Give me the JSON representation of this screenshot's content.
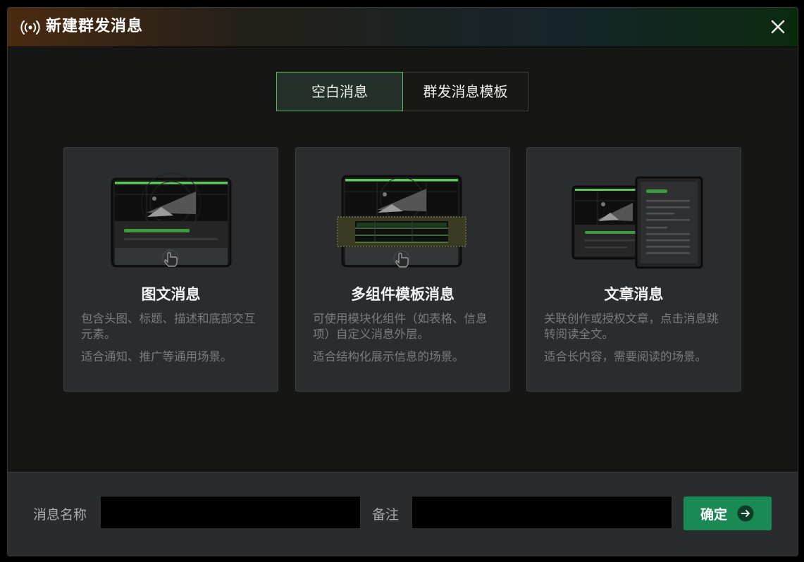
{
  "dialog": {
    "title": "新建群发消息",
    "icon": "broadcast-icon",
    "close_icon": "close-icon"
  },
  "tabs": [
    {
      "label": "空白消息",
      "active": true
    },
    {
      "label": "群发消息模板",
      "active": false
    }
  ],
  "cards": [
    {
      "title": "图文消息",
      "desc1": "包含头图、标题、描述和底部交互元素。",
      "desc2": "适合通知、推广等通用场景。",
      "icon": "pointer-hand-icon"
    },
    {
      "title": "多组件模板消息",
      "desc1": "可使用模块化组件（如表格、信息项）自定义消息外层。",
      "desc2": "适合结构化展示信息的场景。",
      "icon": "pointer-hand-icon"
    },
    {
      "title": "文章消息",
      "desc1": "关联创作或授权文章，点击消息跳转阅读全文。",
      "desc2": "适合长内容，需要阅读的场景。"
    }
  ],
  "footer": {
    "name_label": "消息名称",
    "name_value": "",
    "note_label": "备注",
    "note_value": "",
    "confirm_label": "确定",
    "confirm_icon": "arrow-right-circle-icon"
  },
  "colors": {
    "accent": "#4fbf5a",
    "confirm_bg": "#1a8a54",
    "card_bg": "#2b2c2e",
    "modal_bg": "#161614"
  }
}
